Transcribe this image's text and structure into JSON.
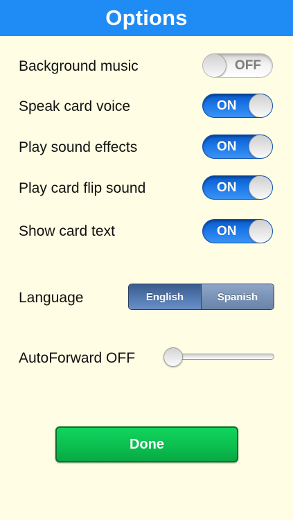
{
  "header": {
    "title": "Options"
  },
  "colors": {
    "header_bg": "#1f8cf6",
    "background": "#fffde3",
    "switch_on": "#1b76e6",
    "done_button": "#0bbd4e"
  },
  "settings": [
    {
      "label": "Background music",
      "state": "OFF",
      "on": false
    },
    {
      "label": "Speak card voice",
      "state": "ON",
      "on": true
    },
    {
      "label": "Play sound effects",
      "state": "ON",
      "on": true
    },
    {
      "label": "Play card flip sound",
      "state": "ON",
      "on": true
    },
    {
      "label": "Show card text",
      "state": "ON",
      "on": true
    }
  ],
  "language": {
    "label": "Language",
    "options": [
      "English",
      "Spanish"
    ],
    "selected": "English"
  },
  "autoforward": {
    "label": "AutoForward OFF",
    "slider_value": 0
  },
  "done_button": {
    "label": "Done"
  }
}
